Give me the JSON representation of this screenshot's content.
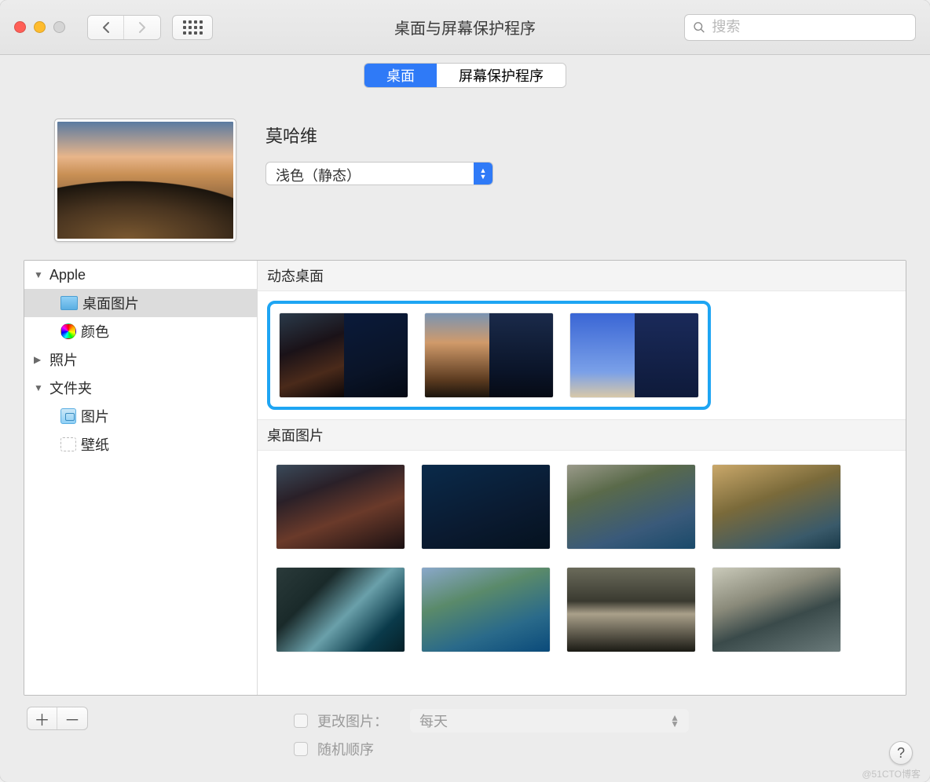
{
  "window": {
    "title": "桌面与屏幕保护程序",
    "search_placeholder": "搜索"
  },
  "tabs": {
    "desktop": "桌面",
    "screensaver": "屏幕保护程序"
  },
  "current": {
    "name": "莫哈维",
    "mode": "浅色（静态）"
  },
  "sidebar": {
    "apple": "Apple",
    "desktop_pictures": "桌面图片",
    "colors": "颜色",
    "photos": "照片",
    "folders": "文件夹",
    "pictures": "图片",
    "wallpapers": "壁纸"
  },
  "gallery": {
    "section_dynamic": "动态桌面",
    "section_pictures": "桌面图片"
  },
  "options": {
    "change_picture_label": "更改图片：",
    "change_interval": "每天",
    "random_order": "随机顺序"
  },
  "watermark": "@51CTO博客"
}
